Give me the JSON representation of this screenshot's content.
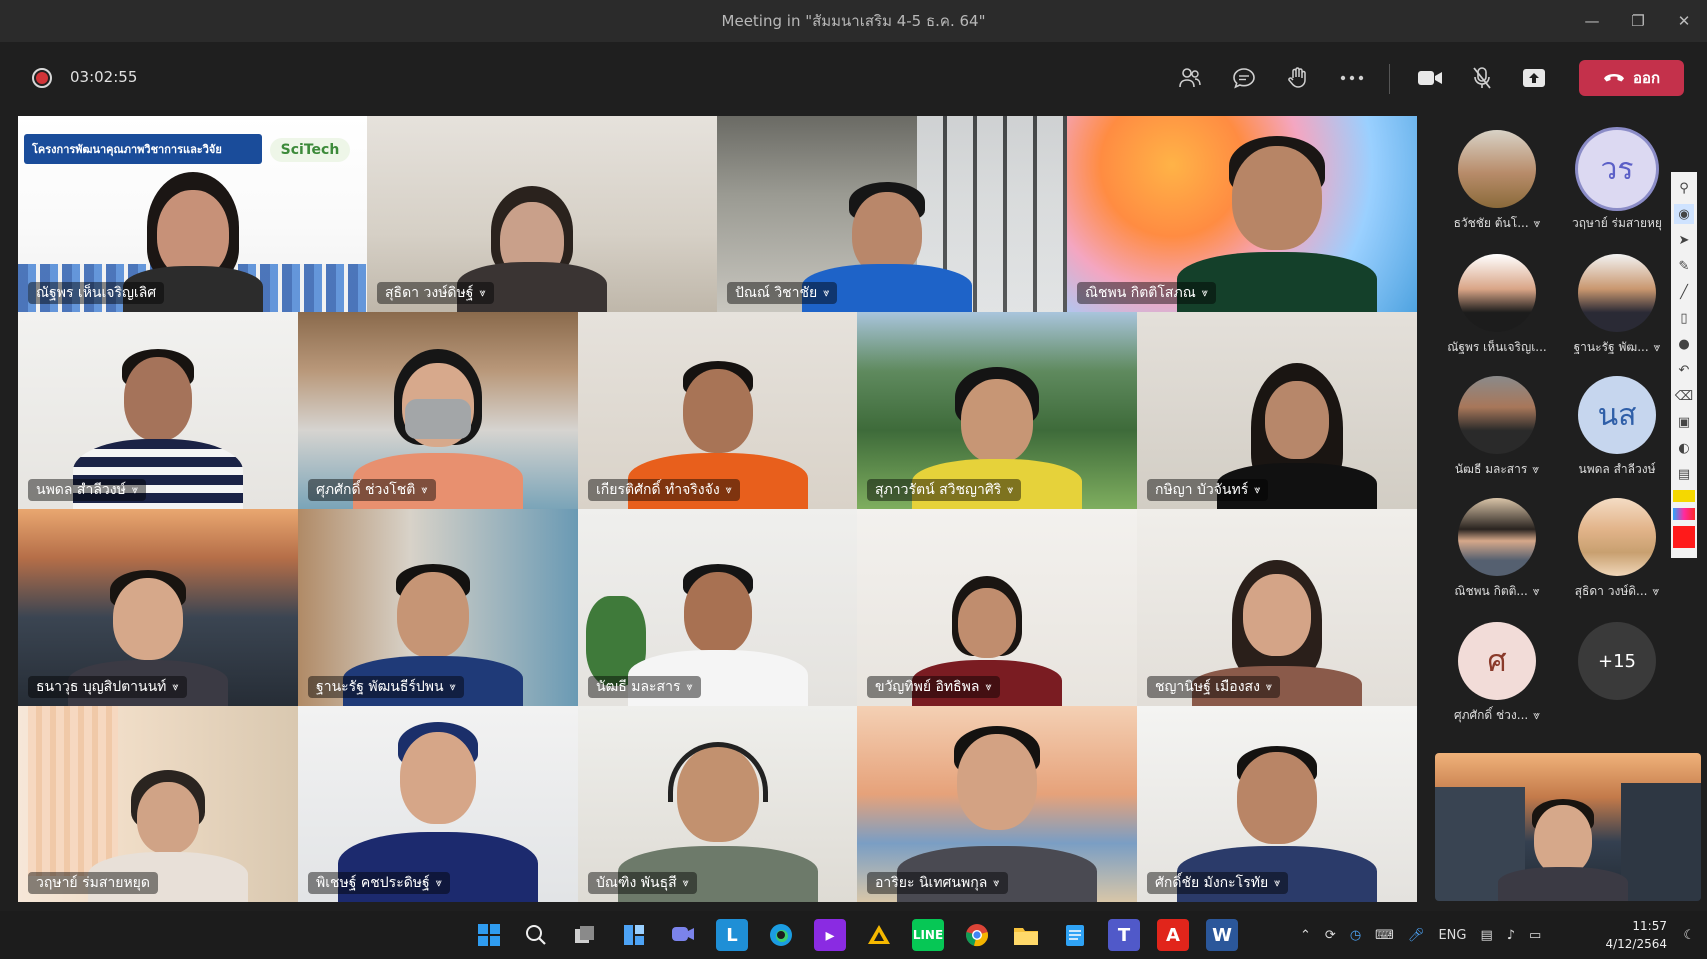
{
  "window": {
    "title": "Meeting in \"สัมมนาเสริม 4-5 ธ.ค. 64\""
  },
  "toolbar": {
    "timer": "03:02:55",
    "leave_label": "ออก",
    "icons": [
      "people-icon",
      "chat-icon",
      "reactions-icon",
      "more-icon"
    ],
    "right_icons": [
      "camera-icon",
      "mic-off-icon",
      "share-icon"
    ]
  },
  "grid": {
    "tiles": [
      {
        "name": "ณัฐพร เห็นเจริญเลิศ",
        "muted": false,
        "slide_title": "โครงการพัฒนาคุณภาพวิชาการและวิจัย",
        "slide_logo": "SciTech"
      },
      {
        "name": "สุธิดา วงษ์ดิษฐ์",
        "muted": true
      },
      {
        "name": "ปัณณ์ วิชาชัย",
        "muted": true
      },
      {
        "name": "ณิชพน กิตติโสภณ",
        "muted": true
      },
      {
        "name": "นพดล สำลีวงษ์",
        "muted": true
      },
      {
        "name": "ศุภศักดิ์ ช่วงโชติ",
        "muted": true
      },
      {
        "name": "เกียรติศักดิ์ ทำจริงจัง",
        "muted": true
      },
      {
        "name": "สุภาวรัตน์ สวิชญาศิริ",
        "muted": true
      },
      {
        "name": "กษิญา บัวจันทร์",
        "muted": true
      },
      {
        "name": "ธนาวุธ บุญสิปตานนท์",
        "muted": true
      },
      {
        "name": "ฐานะรัฐ พัฒนธีร์ปพน",
        "muted": true
      },
      {
        "name": "นัฒธี มละสาร",
        "muted": true
      },
      {
        "name": "ขวัญทิพย์ อิทธิพล",
        "muted": true
      },
      {
        "name": "ชญานิษฐ์ เมืองสง",
        "muted": true
      },
      {
        "name": "วฤษาย์ ร่มสายหยุด",
        "muted": false
      },
      {
        "name": "พิเชษฐ์ คชประดิษฐ์",
        "muted": true
      },
      {
        "name": "บัณฑิง พันธุสี",
        "muted": true
      },
      {
        "name": "อาริยะ นิเทศนพกุล",
        "muted": true
      },
      {
        "name": "ศักดิ์ชัย มังกะโรทัย",
        "muted": true
      }
    ]
  },
  "side_panel": {
    "participants": [
      {
        "name": "ธวัชชัย ต้นโ...",
        "initials": "",
        "muted": true
      },
      {
        "name": "วฤษาย์ ร่มสายหยุ",
        "initials": "วร",
        "muted": false,
        "speaking": true
      },
      {
        "name": "ณัฐพร เห็นเจริญเ...",
        "initials": "",
        "muted": false
      },
      {
        "name": "ฐานะรัฐ พัฒ...",
        "initials": "",
        "muted": true
      },
      {
        "name": "นัฒธี มละสาร",
        "initials": "",
        "muted": true
      },
      {
        "name": "นพดล สำลีวงษ์",
        "initials": "นส",
        "muted": false
      },
      {
        "name": "ณิชพน กิตติ...",
        "initials": "",
        "muted": true
      },
      {
        "name": "สุธิดา วงษ์ดิ...",
        "initials": "",
        "muted": true
      },
      {
        "name": "ศุภศักดิ์ ช่วง...",
        "initials": "ศ",
        "muted": true
      },
      {
        "name": "",
        "initials": "+15",
        "muted": false
      }
    ]
  },
  "taskbar": {
    "lang": "ENG",
    "time": "11:57",
    "date": "4/12/2564"
  }
}
